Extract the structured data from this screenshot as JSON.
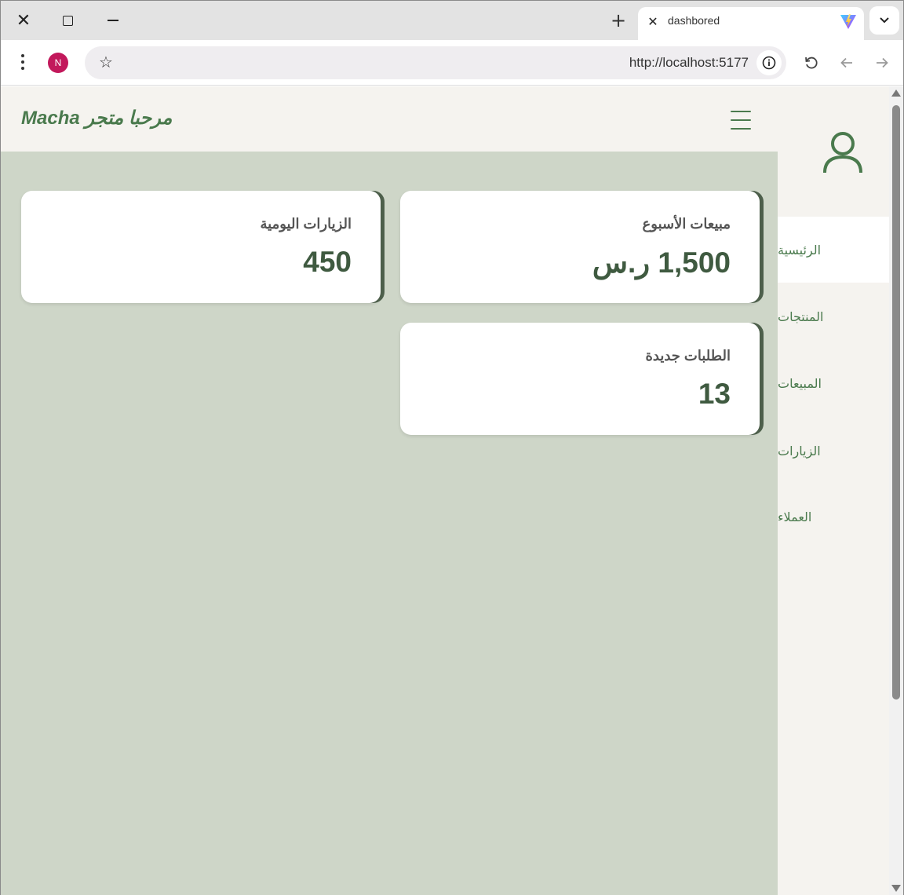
{
  "browser": {
    "tab_title": "dashbored",
    "url": "http://localhost:5177",
    "profile_initial": "N",
    "tab_close_glyph": "✕",
    "newtab_glyph": "+",
    "window_close_glyph": "✕",
    "star_glyph": "☆"
  },
  "header": {
    "welcome": "مرحبا متجر Macha"
  },
  "sidebar": {
    "items": [
      {
        "label": "الرئيسية",
        "active": true
      },
      {
        "label": "المنتجات",
        "active": false
      },
      {
        "label": "المبيعات",
        "active": false
      },
      {
        "label": "الزيارات",
        "active": false
      },
      {
        "label": "العملاء",
        "active": false
      }
    ]
  },
  "cards": [
    {
      "title": "مبيعات الأسبوع",
      "value": "1,500 ر.س"
    },
    {
      "title": "الزيارات اليومية",
      "value": "450"
    },
    {
      "title": "الطلبات جديدة",
      "value": "13"
    }
  ],
  "colors": {
    "accent": "#4a7a4d",
    "content_bg": "#ced6c8",
    "panel_bg": "#f5f3ef",
    "card_border": "#4d5f4b",
    "value_text": "#3f5a40",
    "profile_bg": "#c2185b"
  },
  "icons": {
    "menu": "hamburger-menu-icon",
    "user": "user-icon",
    "reload": "reload-icon",
    "back": "back-arrow-icon",
    "forward": "forward-arrow-icon",
    "site_info": "info-icon",
    "bookmark": "star-icon",
    "more": "kebab-menu-icon",
    "tab_search": "chevron-down-icon"
  }
}
